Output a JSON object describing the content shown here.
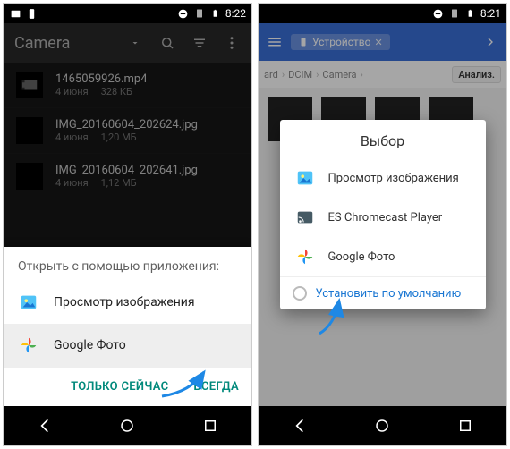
{
  "left": {
    "status_time": "8:22",
    "toolbar_title": "Camera",
    "files": [
      {
        "icon": "video",
        "name": "1465059926.mp4",
        "date": "4 июня",
        "size": "328 КБ"
      },
      {
        "icon": "image",
        "name": "IMG_20160604_202624.jpg",
        "date": "4 июня",
        "size": "1,20 МБ"
      },
      {
        "icon": "image",
        "name": "IMG_20160604_202641.jpg",
        "date": "4 июня",
        "size": "1,12 МБ"
      }
    ],
    "sheet": {
      "title": "Открыть с помощью приложения:",
      "items": [
        {
          "label": "Просмотр изображения",
          "icon": "gallery"
        },
        {
          "label": "Google Фото",
          "icon": "photos"
        }
      ],
      "just_once": "ТОЛЬКО СЕЙЧАС",
      "always": "ВСЕГДА"
    }
  },
  "right": {
    "status_time": "8:21",
    "chip_label": "Устройство",
    "breadcrumb": {
      "p1": "ard",
      "p2": "DCIM",
      "p3": "Camera",
      "tag": "Анализ."
    },
    "dialog": {
      "title": "Выбор",
      "items": [
        {
          "label": "Просмотр изображения",
          "icon": "gallery"
        },
        {
          "label": "ES Chromecast Player",
          "icon": "cast"
        },
        {
          "label": "Google Фото",
          "icon": "photos"
        }
      ],
      "default_label": "Установить по умолчанию"
    }
  }
}
